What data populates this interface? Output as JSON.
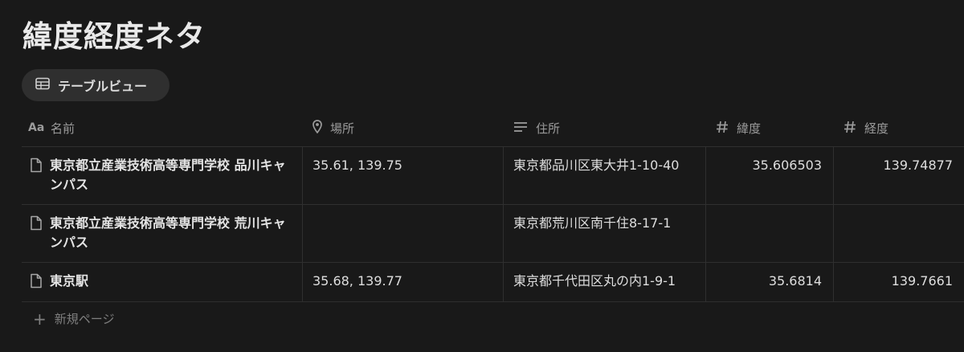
{
  "page": {
    "title": "緯度経度ネタ"
  },
  "view_tab": {
    "label": "テーブルビュー",
    "icon": "table-icon"
  },
  "columns": [
    {
      "label": "名前",
      "icon": "text-property-icon"
    },
    {
      "label": "場所",
      "icon": "location-pin-icon"
    },
    {
      "label": "住所",
      "icon": "text-lines-icon"
    },
    {
      "label": "緯度",
      "icon": "number-icon"
    },
    {
      "label": "経度",
      "icon": "number-icon"
    }
  ],
  "rows": [
    {
      "name": "東京都立産業技術高等専門学校 品川キャンパス",
      "place": "35.61, 139.75",
      "address": "東京都品川区東大井1-10-40",
      "latitude": "35.606503",
      "longitude": "139.74877"
    },
    {
      "name": "東京都立産業技術高等専門学校 荒川キャンパス",
      "place": "",
      "address": "東京都荒川区南千住8-17-1",
      "latitude": "",
      "longitude": ""
    },
    {
      "name": "東京駅",
      "place": "35.68, 139.77",
      "address": "東京都千代田区丸の内1-9-1",
      "latitude": "35.6814",
      "longitude": "139.7661"
    }
  ],
  "new_page": {
    "label": "新規ページ",
    "icon": "plus-icon"
  },
  "colors": {
    "background": "#191919",
    "text": "#dedede",
    "muted": "#9b9b9b",
    "border": "#2f2f2f",
    "tab_bg": "#2f2f2f"
  }
}
